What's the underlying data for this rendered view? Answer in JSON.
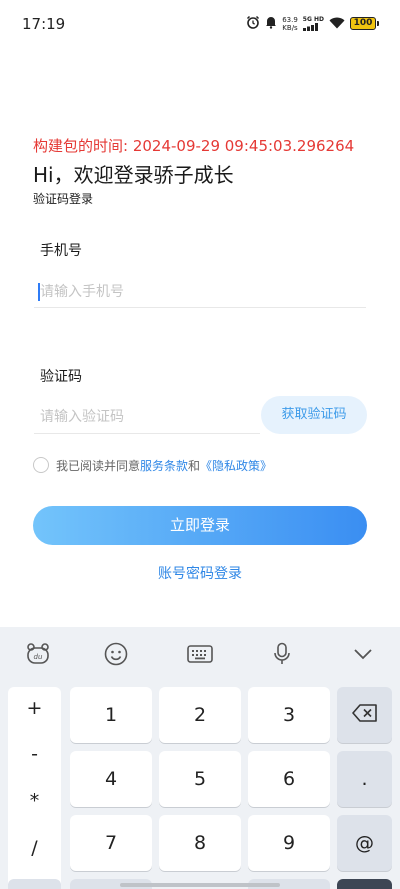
{
  "status_bar": {
    "time": "17:19",
    "net_speed_value": "63.9",
    "net_speed_unit": "KB/s",
    "network_type": "5G HD",
    "battery": "100"
  },
  "header": {
    "build_time": "构建包的时间: 2024-09-29 09:45:03.296264",
    "welcome": "Hi，欢迎登录骄子成长",
    "subtitle": "验证码登录"
  },
  "form": {
    "phone_label": "手机号",
    "phone_placeholder": "请输入手机号",
    "code_label": "验证码",
    "code_placeholder": "请输入验证码",
    "get_code_button": "获取验证码",
    "agreement_prefix": "我已阅读并同意",
    "terms_link": "服务条款",
    "agreement_and": "和",
    "privacy_link": "《隐私政策》",
    "login_button": "立即登录",
    "password_login_link": "账号密码登录"
  },
  "keyboard": {
    "toolbar_icons": [
      "baidu-input-logo-icon",
      "emoji-icon",
      "keyboard-icon",
      "microphone-icon",
      "chevron-down-icon"
    ],
    "symbols": [
      "+",
      "-",
      "*",
      "/"
    ],
    "rows": [
      [
        "1",
        "2",
        "3"
      ],
      [
        "4",
        "5",
        "6"
      ],
      [
        "7",
        "8",
        "9"
      ]
    ],
    "right_keys": [
      "backspace-icon",
      ".",
      "@"
    ]
  },
  "colors": {
    "accent": "#2f87e6",
    "build_time": "#e53935",
    "button_gradient_start": "#73c4fb",
    "button_gradient_end": "#3a8ef2"
  }
}
